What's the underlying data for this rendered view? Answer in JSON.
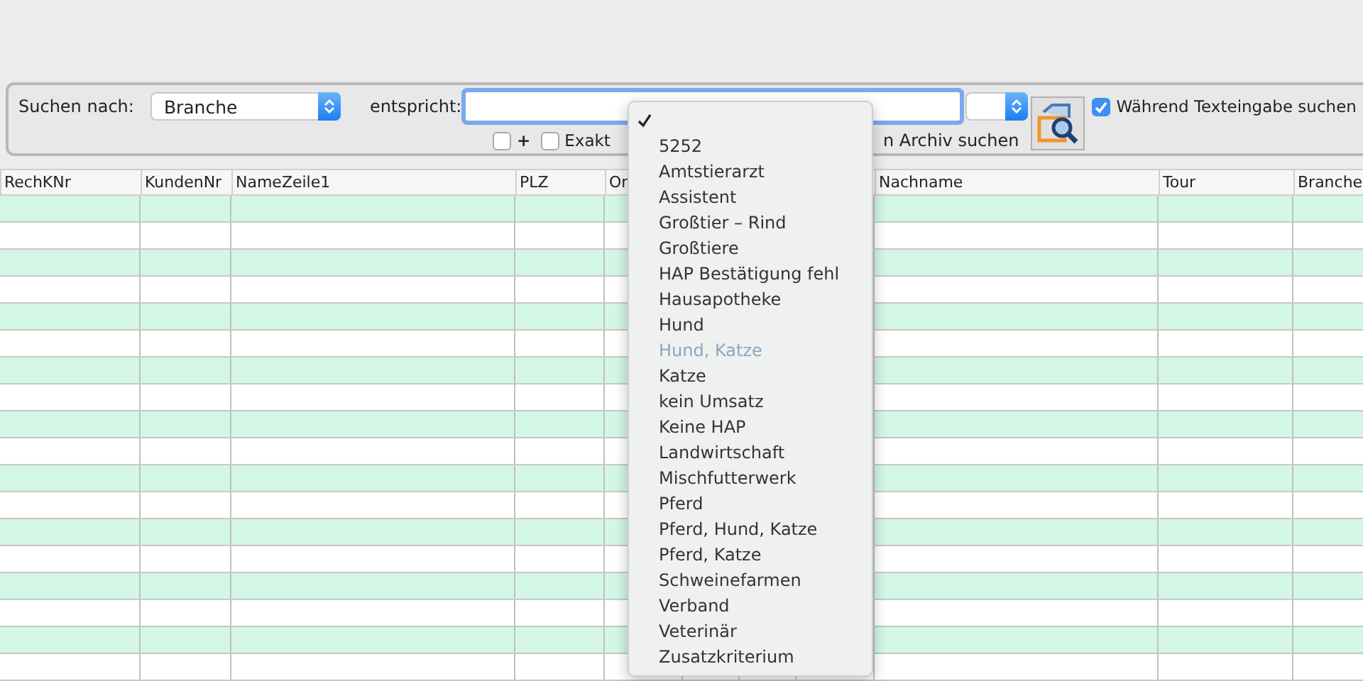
{
  "search_panel": {
    "search_by_label": "Suchen nach:",
    "search_by_value": "Branche",
    "matches_label": "entspricht:",
    "plus_checkbox": {
      "label": "+",
      "checked": false
    },
    "exact_checkbox": {
      "label": "Exakt",
      "checked": false
    },
    "archive_label": "n Archiv suchen",
    "live_search": {
      "label": "Während Texteingabe suchen",
      "checked": true
    }
  },
  "table": {
    "columns": [
      {
        "label": "RechKNr"
      },
      {
        "label": "KundenNr"
      },
      {
        "label": "NameZeile1"
      },
      {
        "label": "PLZ"
      },
      {
        "label": "Or"
      },
      {
        "label": "Nachname"
      },
      {
        "label": "Tour"
      },
      {
        "label": "Branche"
      }
    ]
  },
  "dropdown_menu": {
    "items": [
      {
        "selected": true,
        "disabled": false
      },
      {
        "label": "5252",
        "selected": false,
        "disabled": false
      },
      {
        "label": "Amtstierarzt",
        "selected": false,
        "disabled": false
      },
      {
        "label": "Assistent",
        "selected": false,
        "disabled": false
      },
      {
        "label": "Großtier – Rind",
        "selected": false,
        "disabled": false
      },
      {
        "label": "Großtiere",
        "selected": false,
        "disabled": false
      },
      {
        "label": "HAP Bestätigung fehl",
        "selected": false,
        "disabled": false
      },
      {
        "label": "Hausapotheke",
        "selected": false,
        "disabled": false
      },
      {
        "label": "Hund",
        "selected": false,
        "disabled": false
      },
      {
        "label": "Hund, Katze",
        "selected": false,
        "disabled": true
      },
      {
        "label": "Katze",
        "selected": false,
        "disabled": false
      },
      {
        "label": "kein Umsatz",
        "selected": false,
        "disabled": false
      },
      {
        "label": "Keine HAP",
        "selected": false,
        "disabled": false
      },
      {
        "label": "Landwirtschaft",
        "selected": false,
        "disabled": false
      },
      {
        "label": "Mischfutterwerk",
        "selected": false,
        "disabled": false
      },
      {
        "label": "Pferd",
        "selected": false,
        "disabled": false
      },
      {
        "label": "Pferd, Hund, Katze",
        "selected": false,
        "disabled": false
      },
      {
        "label": "Pferd, Katze",
        "selected": false,
        "disabled": false
      },
      {
        "label": "Schweinefarmen",
        "selected": false,
        "disabled": false
      },
      {
        "label": "Verband",
        "selected": false,
        "disabled": false
      },
      {
        "label": "Veterinär",
        "selected": false,
        "disabled": false
      },
      {
        "label": "Zusatzkriterium",
        "selected": false,
        "disabled": false
      }
    ]
  }
}
